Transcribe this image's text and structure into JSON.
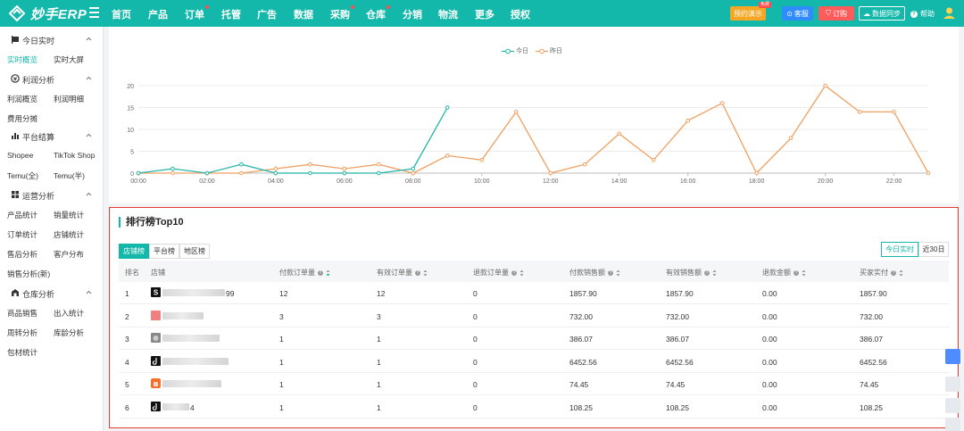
{
  "app": {
    "brand": "妙手ERP"
  },
  "nav": {
    "items": [
      {
        "label": "首页",
        "dot": false
      },
      {
        "label": "产品",
        "dot": false
      },
      {
        "label": "订单",
        "dot": true
      },
      {
        "label": "托管",
        "dot": false
      },
      {
        "label": "广告",
        "dot": false
      },
      {
        "label": "数据",
        "dot": false
      },
      {
        "label": "采购",
        "dot": true
      },
      {
        "label": "仓库",
        "dot": true
      },
      {
        "label": "分销",
        "dot": false
      },
      {
        "label": "物流",
        "dot": false
      },
      {
        "label": "更多",
        "dot": false
      },
      {
        "label": "授权",
        "dot": false
      }
    ],
    "vip_label": "预约演示",
    "vip_badge": "免费",
    "service_label": "客服",
    "order_label": "订购",
    "sync_label": "数据同步",
    "help_label": "帮助"
  },
  "sidebar": {
    "groups": [
      {
        "label": "今日实时",
        "icon": "flag-icon",
        "items": [
          [
            "实时概览",
            "实时大屏"
          ]
        ]
      },
      {
        "label": "利润分析",
        "icon": "coin-icon",
        "items": [
          [
            "利润概览",
            "利润明细"
          ],
          [
            "费用分摊"
          ]
        ]
      },
      {
        "label": "平台结算",
        "icon": "bar-chart-icon",
        "items": [
          [
            "Shopee",
            "TikTok Shop"
          ],
          [
            "Temu(全)",
            "Temu(半)"
          ]
        ]
      },
      {
        "label": "运营分析",
        "icon": "grid-icon",
        "items": [
          [
            "产品统计",
            "销量统计"
          ],
          [
            "订单统计",
            "店铺统计"
          ],
          [
            "售后分析",
            "客户分布"
          ],
          [
            "销售分析(新)"
          ]
        ]
      },
      {
        "label": "仓库分析",
        "icon": "warehouse-icon",
        "items": [
          [
            "商品销售",
            "出入统计"
          ],
          [
            "周转分析",
            "库龄分析"
          ],
          [
            "包材统计"
          ]
        ]
      }
    ],
    "active": "实时概览"
  },
  "chart_data": {
    "type": "line",
    "x": [
      "00:00",
      "01:00",
      "02:00",
      "03:00",
      "04:00",
      "05:00",
      "06:00",
      "07:00",
      "08:00",
      "09:00",
      "10:00",
      "11:00",
      "12:00",
      "13:00",
      "14:00",
      "15:00",
      "16:00",
      "17:00",
      "18:00",
      "19:00",
      "20:00",
      "21:00",
      "22:00",
      "23:00"
    ],
    "x_tick_labels": [
      "00:00",
      "02:00",
      "04:00",
      "06:00",
      "08:00",
      "10:00",
      "12:00",
      "14:00",
      "16:00",
      "18:00",
      "20:00",
      "22:00"
    ],
    "series": [
      {
        "name": "今日",
        "color": "#26b5a8",
        "values": [
          0,
          1,
          0,
          2,
          0,
          0,
          0,
          0,
          1,
          15
        ]
      },
      {
        "name": "昨日",
        "color": "#f0a060",
        "values": [
          0,
          0,
          0,
          0,
          1,
          2,
          1,
          2,
          0,
          4,
          3,
          14,
          0,
          2,
          9,
          3,
          12,
          16,
          0,
          8,
          20,
          14,
          14,
          0
        ]
      }
    ],
    "ylim": [
      0,
      20
    ],
    "y_ticks": [
      0,
      5,
      10,
      15,
      20
    ],
    "grid": true,
    "legend": "top-center"
  },
  "ranking": {
    "title": "排行榜Top10",
    "tabs": [
      "店铺榜",
      "平台榜",
      "地区榜"
    ],
    "active_tab": "店铺榜",
    "range_tabs": [
      "今日实时",
      "近30日"
    ],
    "active_range": "今日实时",
    "columns": [
      "排名",
      "店铺",
      "付款订单量",
      "有效订单量",
      "退款订单量",
      "付款销售额",
      "有效销售额",
      "退款金额",
      "买家实付"
    ],
    "rows": [
      {
        "rank": "1",
        "shop_icon": "shopee-icon",
        "shop_suffix": "99",
        "paid_orders": "12",
        "valid_orders": "12",
        "refund_orders": "0",
        "paid_sales": "1857.90",
        "valid_sales": "1857.90",
        "refund_amount": "0.00",
        "buyer_paid": "1857.90"
      },
      {
        "rank": "2",
        "shop_icon": "shop-red-icon",
        "shop_suffix": "",
        "paid_orders": "3",
        "valid_orders": "3",
        "refund_orders": "0",
        "paid_sales": "732.00",
        "valid_sales": "732.00",
        "refund_amount": "0.00",
        "buyer_paid": "732.00"
      },
      {
        "rank": "3",
        "shop_icon": "temu-icon",
        "shop_suffix": "",
        "paid_orders": "1",
        "valid_orders": "1",
        "refund_orders": "0",
        "paid_sales": "386.07",
        "valid_sales": "386.07",
        "refund_amount": "0.00",
        "buyer_paid": "386.07"
      },
      {
        "rank": "4",
        "shop_icon": "tiktok-icon",
        "shop_suffix": "",
        "paid_orders": "1",
        "valid_orders": "1",
        "refund_orders": "0",
        "paid_sales": "6452.56",
        "valid_sales": "6452.56",
        "refund_amount": "0.00",
        "buyer_paid": "6452.56"
      },
      {
        "rank": "5",
        "shop_icon": "shopee-orange-icon",
        "shop_suffix": "",
        "paid_orders": "1",
        "valid_orders": "1",
        "refund_orders": "0",
        "paid_sales": "74.45",
        "valid_sales": "74.45",
        "refund_amount": "0.00",
        "buyer_paid": "74.45"
      },
      {
        "rank": "6",
        "shop_icon": "tiktok-icon",
        "shop_suffix": "4",
        "paid_orders": "1",
        "valid_orders": "1",
        "refund_orders": "0",
        "paid_sales": "108.25",
        "valid_sales": "108.25",
        "refund_amount": "0.00",
        "buyer_paid": "108.25"
      }
    ]
  }
}
